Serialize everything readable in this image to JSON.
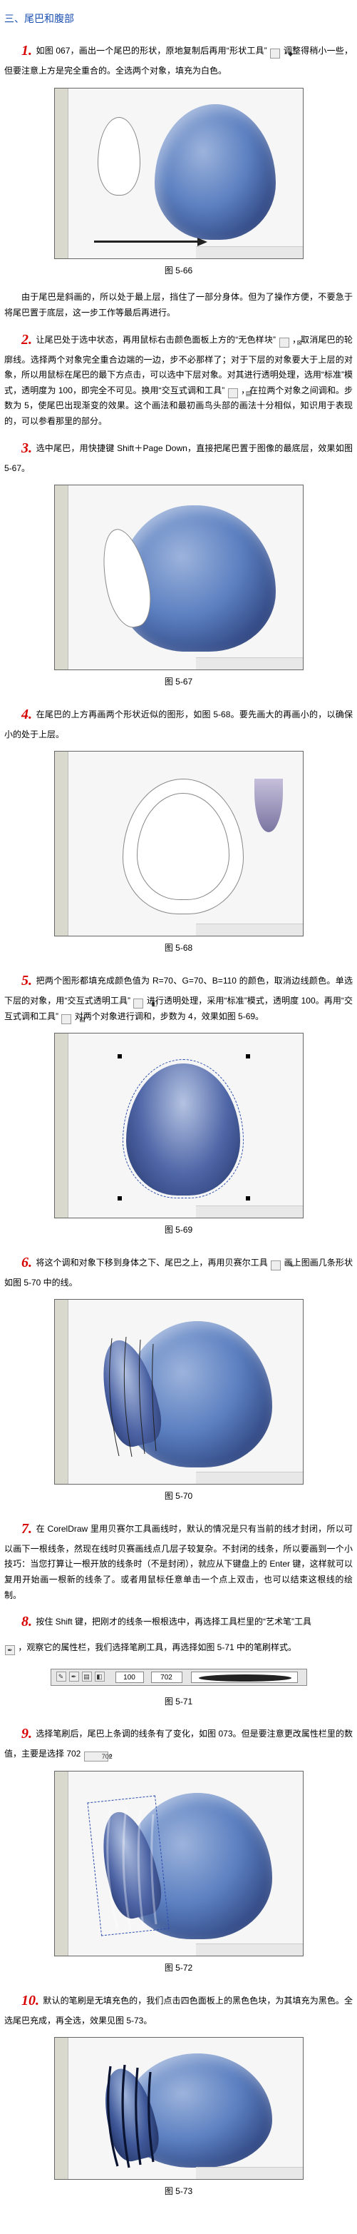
{
  "section_title": "三、尾巴和腹部",
  "step1": {
    "text_a": "如图 067，画出一个尾巴的形状，原地复制后再用“形状工具”",
    "text_b": "调整得稍小一些，但要注意上方是完全重合的。全选两个对象，填充为白色。"
  },
  "fig566_caption": "图 5-66",
  "para_after_566": "由于尾巴是斜画的，所以处于最上层，挡住了一部分身体。但为了操作方便，不要急于将尾巴置于底层，这一步工作等最后再进行。",
  "step2": {
    "text_a": "让尾巴处于选中状态，再用鼠标右击颜色面板上方的“无色样块”",
    "text_b": "，取消尾巴的轮廓线。选择两个对象完全重合边端的一边，步不必那样了；对于下层的对象要大于上层的对象，所以用鼠标在尾巴的最下方点击，可以选中下层对象。对其进行透明处理，选用“标准”模式，透明度为 100，即完全不可见。换用“交互式调和工具”",
    "text_c": "，在拉两个对象之间调和。步数为 5，使尾巴出现渐变的效果。这个画法和最初画鸟头部的画法十分相似，知识用于表现的，可以参看那里的部分。"
  },
  "step3": {
    "text": "选中尾巴，用快捷键 Shift＋Page Down，直接把尾巴置于图像的最底层，效果如图 5-67。"
  },
  "fig567_caption": "图 5-67",
  "step4": {
    "text": "在尾巴的上方再画两个形状近似的图形，如图 5-68。要先画大的再画小的，以确保小的处于上层。"
  },
  "fig568_caption": "图 5-68",
  "step5": {
    "text_a": "把两个图形都填充成颜色值为 R=70、G=70、B=110 的颜色，取消边线颜色。单选下层的对象，用“交互式透明工具”",
    "text_b": "进行透明处理，采用“标准”模式，透明度 100。再用“交互式调和工具”",
    "text_c": "对两个对象进行调和，步数为 4，效果如图 5-69。"
  },
  "fig569_caption": "图 5-69",
  "step6": {
    "text_a": "将这个调和对象下移到身体之下、尾巴之上，再用贝赛尔工具",
    "text_b": "画上图画几条形状如图 5-70 中的线。"
  },
  "fig570_caption": "图 5-70",
  "step7": {
    "text": "在 CorelDraw 里用贝赛尔工具画线时，默认的情况是只有当前的线才封闭，所以可以画下一根线条，然现在线时贝赛画线点几层子较复杂。不封闭的线条，所以要画到一个小技巧：当您打算让一根开放的线条时（不是封闭），就应从下键盘上的 Enter 键，这样就可以复用开始画一根新的线条了。或者用鼠标任意单击一个点上双击，也可以结束这根线的绘制。"
  },
  "step8": {
    "text": "按住 Shift 键，把刚才的线条一根根选中，再选择工具栏里的“艺术笔”工具"
  },
  "step8b": {
    "text": "，观察它的属性栏，我们选择笔刷工具，再选择如图 5-71 中的笔刷样式。"
  },
  "fig571_caption": "图 5-71",
  "step9": {
    "text": "选择笔刷后，尾巴上条调的线条有了变化，如图 073。但是要注意更改属性栏里的数值，主要是选择 702"
  },
  "fig572_caption": "图 5-72",
  "step10": {
    "text": "默认的笔刷是无填充色的，我们点击四色面板上的黑色色块，为其填充为黑色。全选尾巴充成，再全选，效果见图 5-73。"
  },
  "fig573_caption": "图 5-73"
}
